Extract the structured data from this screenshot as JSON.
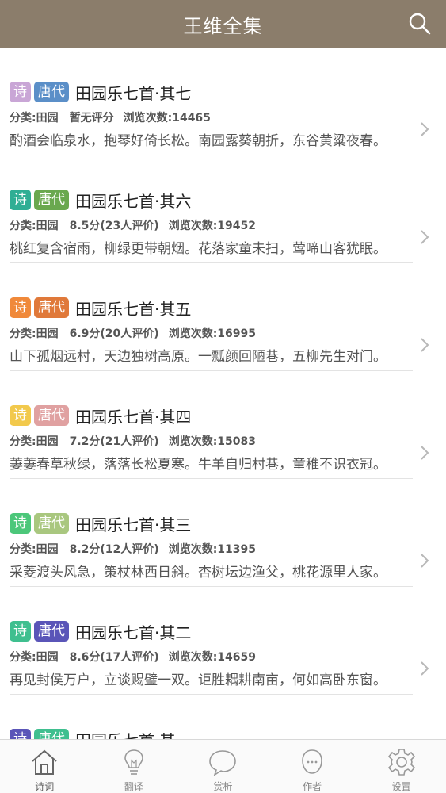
{
  "header": {
    "title": "王维全集",
    "search_icon": "search-icon"
  },
  "poems": [
    {
      "type_tag": "诗",
      "era_tag": "唐代",
      "type_color": "#c9a6d6",
      "era_color": "#5b8fc8",
      "title": "田园乐七首·其七",
      "category": "分类:田园",
      "rating": "暂无评分",
      "views": "浏览次数:14465",
      "excerpt": "酌酒会临泉水，抱琴好倚长松。南园露葵朝折，东谷黄粱夜春。"
    },
    {
      "type_tag": "诗",
      "era_tag": "唐代",
      "type_color": "#2fae94",
      "era_color": "#6aa84f",
      "title": "田园乐七首·其六",
      "category": "分类:田园",
      "rating": "8.5分(23人评价)",
      "views": "浏览次数:19452",
      "excerpt": "桃红复含宿雨，柳绿更带朝烟。花落家童未扫，莺啼山客犹眠。"
    },
    {
      "type_tag": "诗",
      "era_tag": "唐代",
      "type_color": "#f0893a",
      "era_color": "#e0793a",
      "title": "田园乐七首·其五",
      "category": "分类:田园",
      "rating": "6.9分(20人评价)",
      "views": "浏览次数:16995",
      "excerpt": "山下孤烟远村，天边独树高原。一瓢颜回陋巷，五柳先生对门。"
    },
    {
      "type_tag": "诗",
      "era_tag": "唐代",
      "type_color": "#f2c94c",
      "era_color": "#e0a1a1",
      "title": "田园乐七首·其四",
      "category": "分类:田园",
      "rating": "7.2分(21人评价)",
      "views": "浏览次数:15083",
      "excerpt": "萋萋春草秋绿，落落长松夏寒。牛羊自归村巷，童稚不识衣冠。"
    },
    {
      "type_tag": "诗",
      "era_tag": "唐代",
      "type_color": "#4cc77a",
      "era_color": "#a9c77f",
      "title": "田园乐七首·其三",
      "category": "分类:田园",
      "rating": "8.2分(12人评价)",
      "views": "浏览次数:11395",
      "excerpt": "采菱渡头风急，策杖林西日斜。杏树坛边渔父，桃花源里人家。"
    },
    {
      "type_tag": "诗",
      "era_tag": "唐代",
      "type_color": "#3fbf8f",
      "era_color": "#5a55b8",
      "title": "田园乐七首·其二",
      "category": "分类:田园",
      "rating": "8.6分(17人评价)",
      "views": "浏览次数:14659",
      "excerpt": "再见封侯万户，立谈赐璧一双。讵胜耦耕南亩，何如高卧东窗。"
    },
    {
      "type_tag": "诗",
      "era_tag": "唐代",
      "type_color": "#5a55b8",
      "era_color": "#3fbf8f",
      "title": "田园乐七首·其一",
      "category": "",
      "rating": "",
      "views": "",
      "excerpt": ""
    }
  ],
  "tabbar": {
    "tabs": [
      {
        "label": "诗词",
        "icon": "home-icon"
      },
      {
        "label": "翻译",
        "icon": "lightbulb-icon"
      },
      {
        "label": "赏析",
        "icon": "speech-bubble-icon"
      },
      {
        "label": "作者",
        "icon": "person-icon"
      },
      {
        "label": "设置",
        "icon": "gear-icon"
      }
    ],
    "active_index": 0
  }
}
